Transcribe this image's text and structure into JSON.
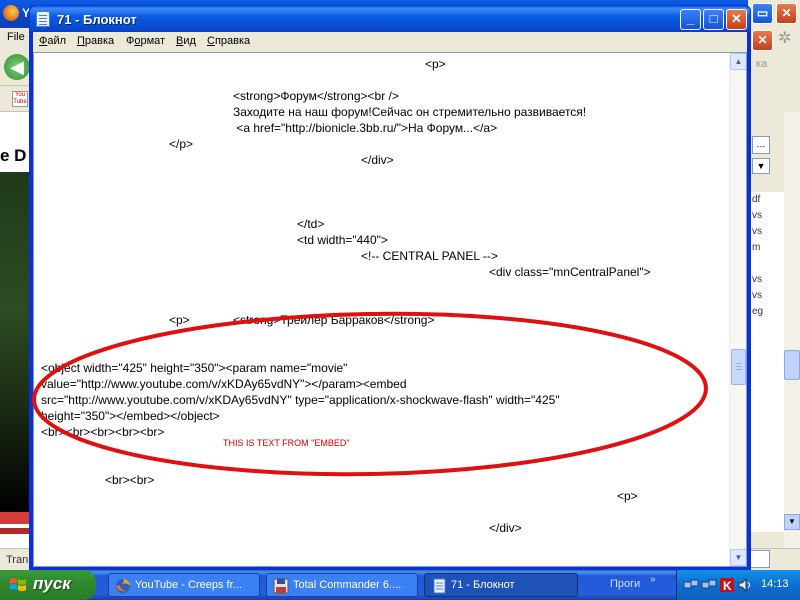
{
  "background_browser": {
    "title": "Yo",
    "menu_file": "File",
    "page_title": "e D",
    "status_text": "Tran",
    "search_hint": "ка",
    "side_items": [
      "df",
      "vs",
      "vs",
      "m",
      "vs",
      "vs",
      "eg"
    ]
  },
  "notepad": {
    "title": "71 - Блокнот",
    "menu": [
      {
        "label": "Файл",
        "accel": "Ф",
        "rest": "айл"
      },
      {
        "label": "Правка",
        "accel": "П",
        "rest": "равка"
      },
      {
        "label": "Формат",
        "accel": "о",
        "pre": "Ф",
        "rest": "рмат"
      },
      {
        "label": "Вид",
        "accel": "В",
        "rest": "ид"
      },
      {
        "label": "Справка",
        "accel": "С",
        "rest": "правка"
      }
    ],
    "lines": [
      "<p>",
      "<strong>Форум</strong><br />",
      "Заходите на наш форум!Сейчас он стремительно развивается!",
      " <a href=\"http://bionicle.3bb.ru/\">На Форум...</a>",
      "</p>",
      "</div>",
      "</td>",
      "<td width=\"440\">",
      "<!-- CENTRAL PANEL -->",
      "<div class=\"mnCentralPanel\">",
      "<p>",
      "<strong>Трейлер Барраков</strong>",
      "<object width=\"425\" height=\"350\"><param name=\"movie\"",
      "value=\"http://www.youtube.com/v/xKDAy65vdNY\"></param><embed",
      "src=\"http://www.youtube.com/v/xKDAy65vdNY\" type=\"application/x-shockwave-flash\" width=\"425\"",
      "height=\"350\"></embed></object>",
      "<br><br><br><br><br>",
      "<br><br>",
      "<p>",
      "</div>"
    ],
    "annotation": "THIS IS TEXT FROM \"EMBED\""
  },
  "taskbar": {
    "start_label": "пуск",
    "tasks": [
      {
        "label": "YouTube - Creeps fr...",
        "icon": "firefox-icon"
      },
      {
        "label": "Total Commander 6....",
        "icon": "floppy-disk-icon"
      },
      {
        "label": "71 - Блокнот",
        "icon": "notepad-icon"
      }
    ],
    "quick_label": "Проги",
    "quick_chevron": "»",
    "clock": "14:13"
  },
  "colors": {
    "annotation": "#d40000",
    "xp_blue": "#0a5ce4",
    "start_green": "#2f8a2f"
  }
}
